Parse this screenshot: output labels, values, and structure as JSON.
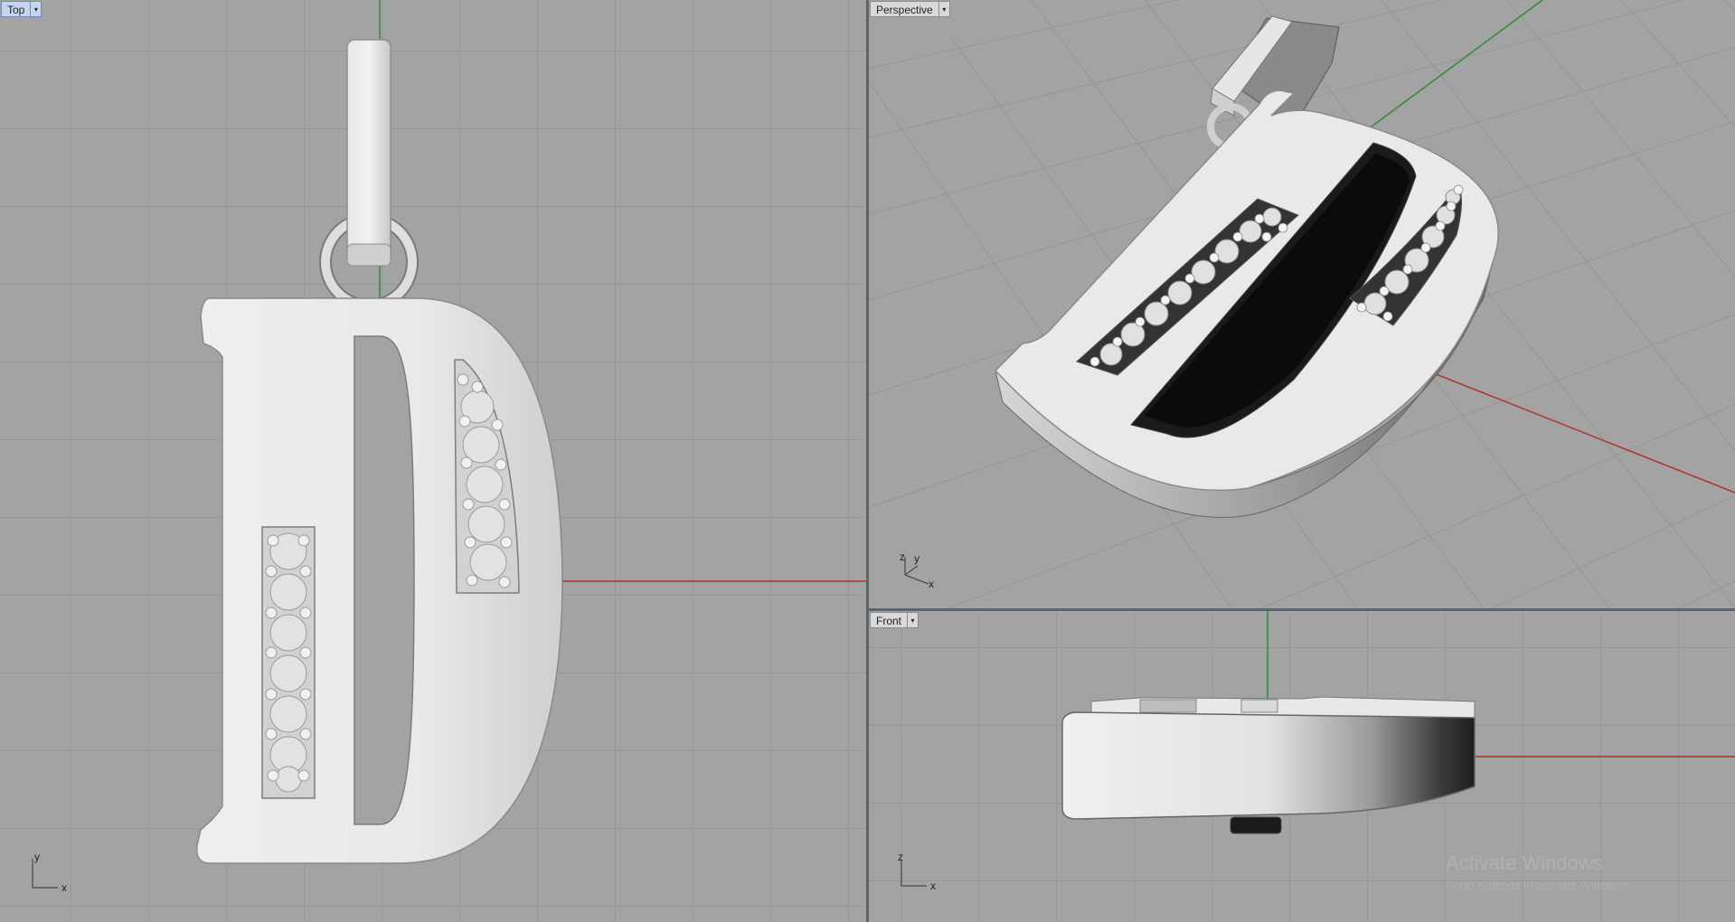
{
  "viewports": {
    "top": {
      "label": "Top",
      "axis_v": "y",
      "axis_h": "x"
    },
    "perspective": {
      "label": "Perspective",
      "axis_a": "z",
      "axis_b": "y",
      "axis_h": "x"
    },
    "front": {
      "label": "Front",
      "axis_v": "z",
      "axis_h": "x"
    }
  },
  "dropdown_glyph": "▾",
  "watermark": {
    "line1": "Activate Windows",
    "line2": "Go to Settings to activate Windows."
  },
  "colors": {
    "viewport_bg": "#a3a3a3",
    "grid": "#979797",
    "x_axis": "#b0302a",
    "y_axis": "#2e8b2e",
    "active_label": "#c6d6ec",
    "frame": "#5c6470"
  },
  "scene": {
    "object": "letter-D-pendant"
  }
}
